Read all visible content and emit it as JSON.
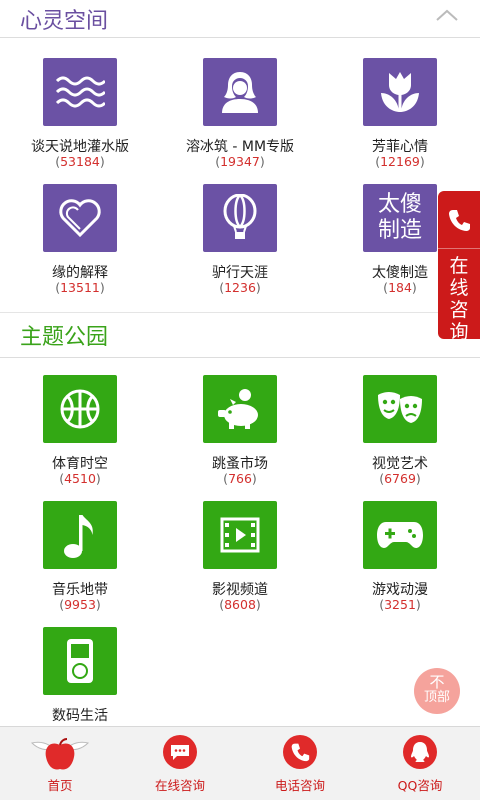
{
  "sections": [
    {
      "title": "心灵空间",
      "items": [
        {
          "name": "谈天说地灌水版",
          "count": "53184",
          "icon": "waves-icon"
        },
        {
          "name": "溶冰筑 - MM专版",
          "count": "19347",
          "icon": "woman-avatar-icon"
        },
        {
          "name": "芳菲心情",
          "count": "12169",
          "icon": "tulip-icon"
        },
        {
          "name": "缘的解释",
          "count": "13511",
          "icon": "heart-icon"
        },
        {
          "name": "驴行天涯",
          "count": "1236",
          "icon": "hot-air-balloon-icon"
        },
        {
          "name": "太傻制造",
          "count": "184",
          "icon": "text-logo-icon",
          "logo_text": "太傻制造"
        }
      ]
    },
    {
      "title": "主题公园",
      "items": [
        {
          "name": "体育时空",
          "count": "4510",
          "icon": "basketball-icon"
        },
        {
          "name": "跳蚤市场",
          "count": "766",
          "icon": "piggy-bank-icon"
        },
        {
          "name": "视觉艺术",
          "count": "6769",
          "icon": "theater-masks-icon"
        },
        {
          "name": "音乐地带",
          "count": "9953",
          "icon": "music-note-icon"
        },
        {
          "name": "影视频道",
          "count": "8608",
          "icon": "film-icon"
        },
        {
          "name": "游戏动漫",
          "count": "3251",
          "icon": "gamepad-icon"
        },
        {
          "name": "数码生活",
          "count": "",
          "icon": "music-player-icon"
        }
      ]
    }
  ],
  "float_tab": {
    "text": "在线咨询"
  },
  "top_button": {
    "line1": "不",
    "line2": "顶部"
  },
  "tabbar": [
    {
      "label": "首页",
      "icon": "apple-wings-icon"
    },
    {
      "label": "在线咨询",
      "icon": "chat-bubble-icon"
    },
    {
      "label": "电话咨询",
      "icon": "phone-icon"
    },
    {
      "label": "QQ咨询",
      "icon": "qq-icon"
    }
  ],
  "colors": {
    "purple": "#6b52a5",
    "green": "#33a814",
    "red": "#cc1a1a",
    "count": "#d3302e"
  }
}
